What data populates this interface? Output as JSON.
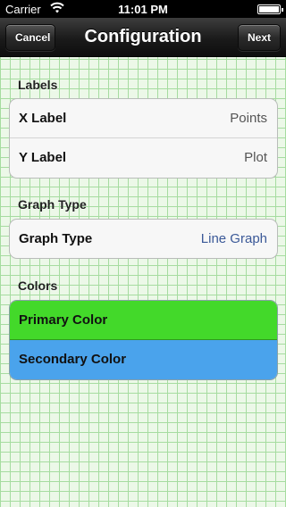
{
  "status_bar": {
    "carrier": "Carrier",
    "time": "11:01 PM",
    "wifi_icon": "wifi-icon",
    "battery_icon": "battery-icon"
  },
  "nav_bar": {
    "title": "Configuration",
    "cancel_label": "Cancel",
    "next_label": "Next"
  },
  "sections": {
    "labels": {
      "header": "Labels",
      "rows": [
        {
          "label": "X Label",
          "value": "Points"
        },
        {
          "label": "Y Label",
          "value": "Plot"
        }
      ]
    },
    "graph_type": {
      "header": "Graph Type",
      "rows": [
        {
          "label": "Graph Type",
          "value": "Line Graph"
        }
      ]
    },
    "colors": {
      "header": "Colors",
      "rows": [
        {
          "label": "Primary Color",
          "color": "#43d92a"
        },
        {
          "label": "Secondary Color",
          "color": "#4aa3ec"
        }
      ]
    }
  },
  "colors": {
    "grid_background": "#ecf8e8",
    "grid_line": "#a6dca0",
    "value_gray": "#555555",
    "value_blue": "#3b5998"
  }
}
